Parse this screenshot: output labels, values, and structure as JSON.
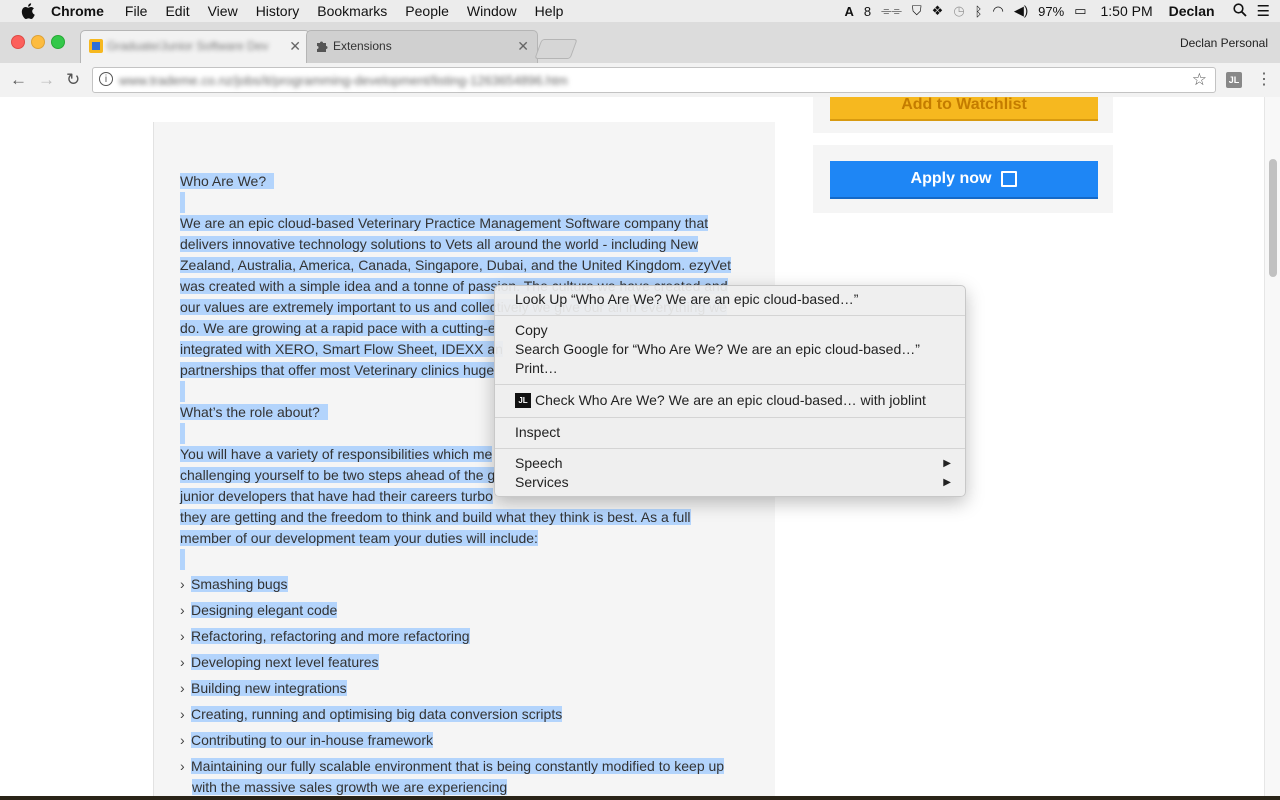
{
  "menubar": {
    "app": "Chrome",
    "items": [
      "File",
      "Edit",
      "View",
      "History",
      "Bookmarks",
      "People",
      "Window",
      "Help"
    ],
    "status": {
      "notifications": "8",
      "battery": "97%",
      "time": "1:50 PM",
      "user": "Declan"
    }
  },
  "browser": {
    "tabs": [
      {
        "label": "Graduate/Junior Software Dev",
        "active": true
      },
      {
        "label": "Extensions",
        "active": false
      }
    ],
    "profile": "Declan Personal",
    "url": "www.trademe.co.nz/jobs/it/programming-development/listing-1263654896.htm"
  },
  "sidebar": {
    "watchlist_label": "Add to Watchlist",
    "apply_label": "Apply now"
  },
  "article": {
    "heading1": "Who Are We?",
    "intro_lines": [
      "We are an epic cloud-based Veterinary Practice Management Software company that",
      "delivers innovative technology solutions to Vets all around the world - including New",
      "Zealand, Australia, America, Canada, Singapore, Dubai, and the United Kingdom. ezyVet",
      "was created with a simple idea and a tonne of passion. The culture we have created and",
      "our values are extremely important to us and collectively we give our all in everything we",
      "do. We are growing at a rapid pace with a cutting-e",
      "integrated with XERO, Smart Flow Sheet, IDEXX an",
      "partnerships that offer most Veterinary clinics huge"
    ],
    "heading2": "What’s the role about?",
    "role_lines": [
      "You will have a variety of responsibilities which me",
      "challenging yourself to be two steps ahead of the g",
      "junior developers that have had their careers turbo",
      "they are getting and the freedom to think and build what they think is best. As a full",
      "member of our development team your duties will include:"
    ],
    "duties": [
      "Smashing bugs",
      "Designing elegant code",
      "Refactoring, refactoring and more refactoring",
      "Developing next level features",
      "Building new integrations",
      "Creating, running and optimising big data conversion scripts",
      "Contributing to our in-house framework",
      "Maintaining our fully scalable environment that is being constantly modified to keep up"
    ],
    "duty_continuation": "with the massive sales growth we are experiencing"
  },
  "context_menu": {
    "look_up": "Look Up “Who Are We?   We are an epic cloud-based…”",
    "copy": "Copy",
    "search_google": "Search Google for “Who Are We?   We are an epic cloud-based…”",
    "print": "Print…",
    "joblint_badge": "JL",
    "joblint": "Check Who Are We?   We are an epic cloud-based… with joblint",
    "inspect": "Inspect",
    "speech": "Speech",
    "services": "Services"
  },
  "colors": {
    "selection": "#b3d4fc",
    "watchlist": "#f6b81f",
    "apply": "#1e86f5"
  }
}
